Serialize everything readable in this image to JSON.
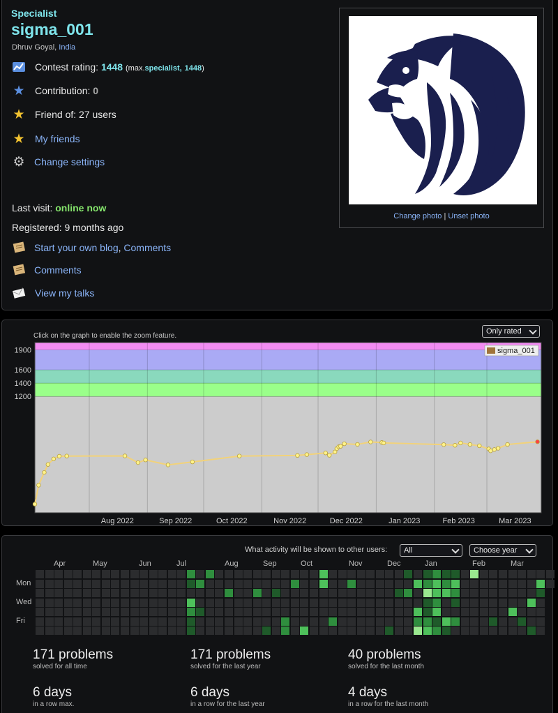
{
  "profile": {
    "rank": "Specialist",
    "handle": "sigma_001",
    "real_name": "Dhruv Goyal",
    "name_separator": ",",
    "country": "India",
    "contest_rating_label": "Contest rating:",
    "contest_rating": "1448",
    "max_prefix": "(max.",
    "max_rank": "specialist,",
    "max_rating": "1448",
    "max_suffix": ")",
    "contribution_label": "Contribution:",
    "contribution": "0",
    "friend_of": "Friend of: 27 users",
    "my_friends": "My friends",
    "change_settings": "Change settings",
    "last_visit_label": "Last visit:",
    "last_visit": "online now",
    "registered": "Registered: 9 months ago",
    "start_blog": "Start your own blog",
    "link_separator": ",",
    "comments_inline": "Comments",
    "comments": "Comments",
    "view_talks": "View my talks",
    "change_photo": "Change photo",
    "photo_separator": "|",
    "unset_photo": "Unset photo"
  },
  "icons": {
    "rating": "rating-chart-icon",
    "contribution": "blue-star-icon",
    "friend_of": "gold-star-icon",
    "my_friends": "gold-star-icon",
    "settings": "gear-icon",
    "blog": "blog-icon",
    "comments": "comment-icon",
    "talks": "envelope-icon"
  },
  "rating_graph": {
    "hint": "Click on the graph to enable the zoom feature.",
    "filter_value": "Only rated"
  },
  "chart_data": {
    "type": "line",
    "title": "",
    "xlabel": "",
    "ylabel": "",
    "x_ticks": [
      "Aug 2022",
      "Sep 2022",
      "Oct 2022",
      "Nov 2022",
      "Dec 2022",
      "Jan 2023",
      "Feb 2023",
      "Mar 2023"
    ],
    "y_ticks": [
      1200,
      1400,
      1600,
      1900
    ],
    "ylim": [
      -550,
      2010
    ],
    "xlim": [
      "2022-07-03",
      "2023-03-30"
    ],
    "grid": true,
    "legend_position": "top-right",
    "colors": {
      "line": "#f2d27a",
      "point": "#fff38a",
      "last_point": "#ff4040"
    },
    "bands": [
      {
        "from": -550,
        "to": 1200,
        "color": "#cccccc"
      },
      {
        "from": 1200,
        "to": 1400,
        "color": "#9aff8a"
      },
      {
        "from": 1400,
        "to": 1600,
        "color": "#8ad9bd"
      },
      {
        "from": 1600,
        "to": 1900,
        "color": "#aaaaf5"
      },
      {
        "from": 1900,
        "to": 2010,
        "color": "#f28cf2"
      }
    ],
    "series": [
      {
        "name": "sigma_001",
        "color": "#a0743a",
        "x": [
          "2022-07-03",
          "2022-07-05",
          "2022-07-08",
          "2022-07-10",
          "2022-07-13",
          "2022-07-16",
          "2022-07-20",
          "2022-08-20",
          "2022-08-27",
          "2022-08-31",
          "2022-09-12",
          "2022-09-25",
          "2022-10-20",
          "2022-11-20",
          "2022-11-25",
          "2022-12-05",
          "2022-12-07",
          "2022-12-10",
          "2022-12-11",
          "2022-12-12",
          "2022-12-13",
          "2022-12-15",
          "2022-12-22",
          "2022-12-29",
          "2023-01-04",
          "2023-01-05",
          "2023-02-06",
          "2023-02-12",
          "2023-02-15",
          "2023-02-20",
          "2023-02-25",
          "2023-03-02",
          "2023-03-03",
          "2023-03-05",
          "2023-03-07",
          "2023-03-12",
          "2023-03-28"
        ],
        "values": [
          -420,
          -135,
          57,
          177,
          260,
          300,
          303,
          305,
          205,
          245,
          170,
          215,
          303,
          312,
          325,
          350,
          315,
          365,
          415,
          443,
          450,
          488,
          478,
          515,
          507,
          500,
          475,
          465,
          500,
          477,
          458,
          410,
          382,
          401,
          420,
          477,
          518
        ]
      }
    ]
  },
  "activity": {
    "visibility_label": "What activity will be shown to other users:",
    "visibility_value": "All",
    "year_value": "Choose year",
    "months": [
      "Apr",
      "May",
      "Jun",
      "Jul",
      "Aug",
      "Sep",
      "Oct",
      "Nov",
      "Dec",
      "Jan",
      "Feb",
      "Mar"
    ],
    "days": [
      "Mon",
      "Wed",
      "Fri"
    ],
    "stats": [
      {
        "value": "171 problems",
        "label": "solved for all time"
      },
      {
        "value": "171 problems",
        "label": "solved for the last year"
      },
      {
        "value": "40 problems",
        "label": "solved for the last month"
      },
      {
        "value": "6 days",
        "label": "in a row max."
      },
      {
        "value": "6 days",
        "label": "in a row for the last year"
      },
      {
        "value": "4 days",
        "label": "in a row for the last month"
      }
    ],
    "heatmap_colors": [
      "#2b2c2e",
      "#1f5a2a",
      "#2f8e3e",
      "#4ec05b",
      "#9ae88f"
    ]
  }
}
